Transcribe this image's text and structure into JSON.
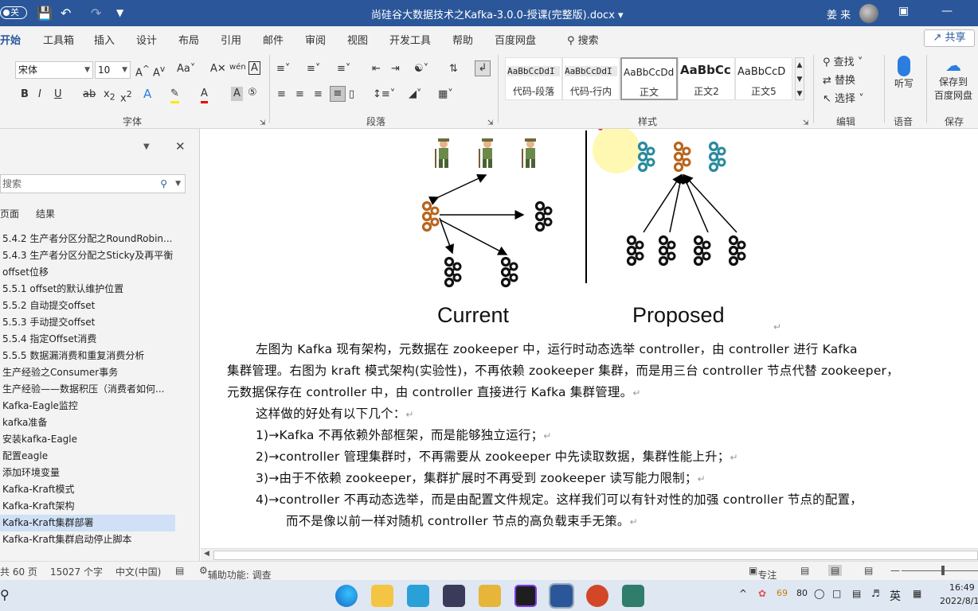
{
  "titlebar": {
    "autosave": "关",
    "document_title": "尚硅谷大数据技术之Kafka-3.0.0-授课(完整版).docx",
    "user_name": "姜 来"
  },
  "ribbon_tabs": [
    "开始",
    "工具箱",
    "插入",
    "设计",
    "布局",
    "引用",
    "邮件",
    "审阅",
    "视图",
    "开发工具",
    "帮助",
    "百度网盘"
  ],
  "ribbon_search": "搜索",
  "share_label": "共享",
  "font": {
    "name": "宋体",
    "size": "10",
    "group_label": "字体"
  },
  "paragraph_group_label": "段落",
  "styles": {
    "group_label": "样式",
    "items": [
      {
        "sample": "AaBbCcDdI",
        "name": "代码-段落"
      },
      {
        "sample": "AaBbCcDdI",
        "name": "代码-行内"
      },
      {
        "sample": "AaBbCcDd",
        "name": "正文"
      },
      {
        "sample": "AaBbCc",
        "name": "正文2"
      },
      {
        "sample": "AaBbCcD",
        "name": "正文5"
      }
    ]
  },
  "editing": {
    "find": "查找",
    "replace": "替换",
    "select": "选择",
    "group_label": "编辑"
  },
  "voice": {
    "dictate": "听写",
    "group_label": "语音"
  },
  "save": {
    "label_1": "保存到",
    "label_2": "百度网盘",
    "group_label": "保存"
  },
  "navpane": {
    "search_placeholder": "搜索",
    "tab_pages": "页面",
    "tab_results": "结果",
    "items": [
      "5.4.2 生产者分区分配之RoundRobin...",
      "5.4.3 生产者分区分配之Sticky及再平衡",
      "offset位移",
      "5.5.1 offset的默认维护位置",
      "5.5.2 自动提交offset",
      "5.5.3 手动提交offset",
      "5.5.4 指定Offset消费",
      "5.5.5 数据漏消费和重复消费分析",
      "生产经验之Consumer事务",
      "生产经验——数据积压（消费者如何...",
      "Kafka-Eagle监控",
      "kafka准备",
      "安装kafka-Eagle",
      "配置eagle",
      "添加环境变量",
      "Kafka-Kraft模式",
      "Kafka-Kraft架构",
      "Kafka-Kraft集群部署",
      "Kafka-Kraft集群启动停止脚本"
    ],
    "selected_index": 17
  },
  "document": {
    "caption_current": "Current",
    "caption_proposed": "Proposed",
    "para1_line1": "左图为 Kafka 现有架构，元数据在 zookeeper 中，运行时动态选举 controller，由 controller 进行 Kafka",
    "para1_line2": "集群管理。右图为 kraft 模式架构(实验性)，不再依赖 zookeeper 集群，而是用三台 controller 节点代替 zookeeper，",
    "para1_line3": "元数据保存在 controller 中，由 controller 直接进行 Kafka 集群管理。",
    "para2": "这样做的好处有以下几个：",
    "list": [
      "1)→Kafka 不再依赖外部框架，而是能够独立运行；",
      "2)→controller 管理集群时，不再需要从 zookeeper 中先读取数据，集群性能上升；",
      "3)→由于不依赖 zookeeper，集群扩展时不再受到 zookeeper 读写能力限制；",
      "4)→controller 不再动态选举，而是由配置文件规定。这样我们可以有针对性的加强 controller 节点的配置，"
    ],
    "list_cont": "而不是像以前一样对随机 controller 节点的高负载束手无策。"
  },
  "status": {
    "pages": "共 60 页",
    "words": "15027 个字",
    "language": "中文(中国)",
    "accessibility": "辅助功能: 调查",
    "focus": "专注"
  },
  "taskbar": {
    "temp": "69",
    "num": "80",
    "ime": "英",
    "time": "16:49",
    "date": "2022/8/1"
  },
  "colors": {
    "accent": "#2b579a",
    "kafka_orange": "#b8651c",
    "kafka_teal": "#2a8a9e",
    "nav_selected": "#cfe0f7"
  }
}
